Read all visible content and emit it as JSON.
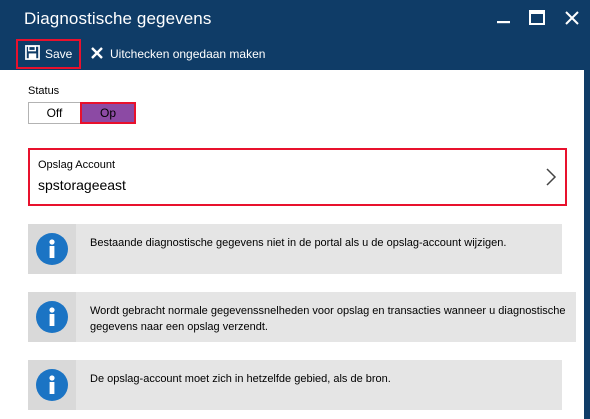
{
  "window": {
    "title": "Diagnostische gegevens"
  },
  "toolbar": {
    "save_label": "Save",
    "undo_label": "Uitchecken ongedaan maken"
  },
  "status": {
    "label": "Status",
    "off_label": "Off",
    "on_label": "Op",
    "selected": "Op"
  },
  "storage": {
    "label": "Opslag Account",
    "value": "spstorageeast"
  },
  "info_messages": [
    {
      "text": "Bestaande diagnostische gegevens niet in de portal als u de opslag-account wijzigen."
    },
    {
      "text": "Wordt gebracht normale gegevenssnelheden voor opslag en transacties wanneer u diagnostische gegevens naar een opslag verzendt."
    },
    {
      "text": "De opslag-account moet zich in hetzelfde gebied, als de bron."
    }
  ],
  "colors": {
    "header_bg": "#0f3c67",
    "toggle_on": "#8c4aa4",
    "highlight_border": "#e8112d",
    "info_icon": "#1b74c4",
    "info_bg": "#e5e5e5"
  },
  "icons": {
    "save": "floppy-disk-icon",
    "undo": "close-x-icon",
    "minimize": "minimize-icon",
    "maximize": "maximize-icon",
    "close": "close-icon",
    "chevron": "chevron-right-icon",
    "info": "info-icon"
  }
}
